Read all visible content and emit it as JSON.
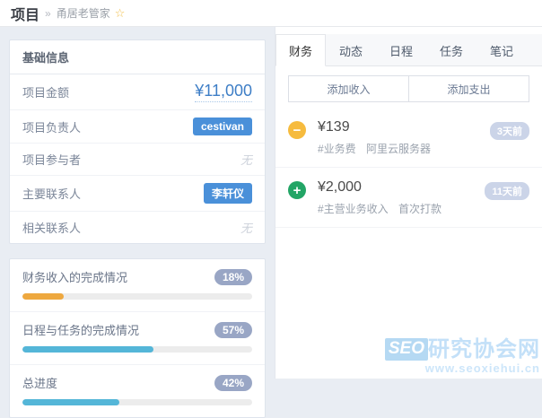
{
  "header": {
    "title": "项目",
    "separator": "»",
    "project_name": "甬居老管家",
    "star": "☆"
  },
  "basic_info": {
    "title": "基础信息",
    "rows": [
      {
        "label": "项目金额",
        "value": "¥11,000",
        "type": "amount"
      },
      {
        "label": "项目负责人",
        "value": "cestivan",
        "type": "badge"
      },
      {
        "label": "项目参与者",
        "value": "无",
        "type": "empty"
      },
      {
        "label": "主要联系人",
        "value": "李轩仪",
        "type": "badge"
      },
      {
        "label": "相关联系人",
        "value": "无",
        "type": "empty"
      }
    ]
  },
  "progress": {
    "items": [
      {
        "label": "财务收入的完成情况",
        "percent": "18%",
        "value": 18,
        "color": "#eea83f"
      },
      {
        "label": "日程与任务的完成情况",
        "percent": "57%",
        "value": 57,
        "color": "#54b6d8"
      },
      {
        "label": "总进度",
        "percent": "42%",
        "value": 42,
        "color": "#54b6d8"
      }
    ]
  },
  "tabs": [
    {
      "label": "财务",
      "active": true
    },
    {
      "label": "动态",
      "active": false
    },
    {
      "label": "日程",
      "active": false
    },
    {
      "label": "任务",
      "active": false
    },
    {
      "label": "笔记",
      "active": false
    }
  ],
  "actions": {
    "add_income": "添加收入",
    "add_expense": "添加支出"
  },
  "transactions": [
    {
      "kind": "expense",
      "glyph": "−",
      "icon_color": "#f6bb3e",
      "amount": "¥139",
      "tag": "#业务费",
      "note": "阿里云服务器",
      "time": "3天前"
    },
    {
      "kind": "income",
      "glyph": "+",
      "icon_color": "#23a566",
      "amount": "¥2,000",
      "tag": "#主营业务收入",
      "note": "首次打款",
      "time": "11天前"
    }
  ],
  "watermark": {
    "logo": "SEO",
    "text": "研究协会网",
    "url": "www.seoxiehui.cn"
  },
  "colors": {
    "accent_blue": "#4a90d9",
    "amount_blue": "#3e7ec6",
    "pill_gray_blue": "#99a6c5",
    "expense_orange": "#f6bb3e",
    "income_green": "#23a566",
    "time_badge": "#cbd4e8",
    "background": "#e9edf3"
  }
}
